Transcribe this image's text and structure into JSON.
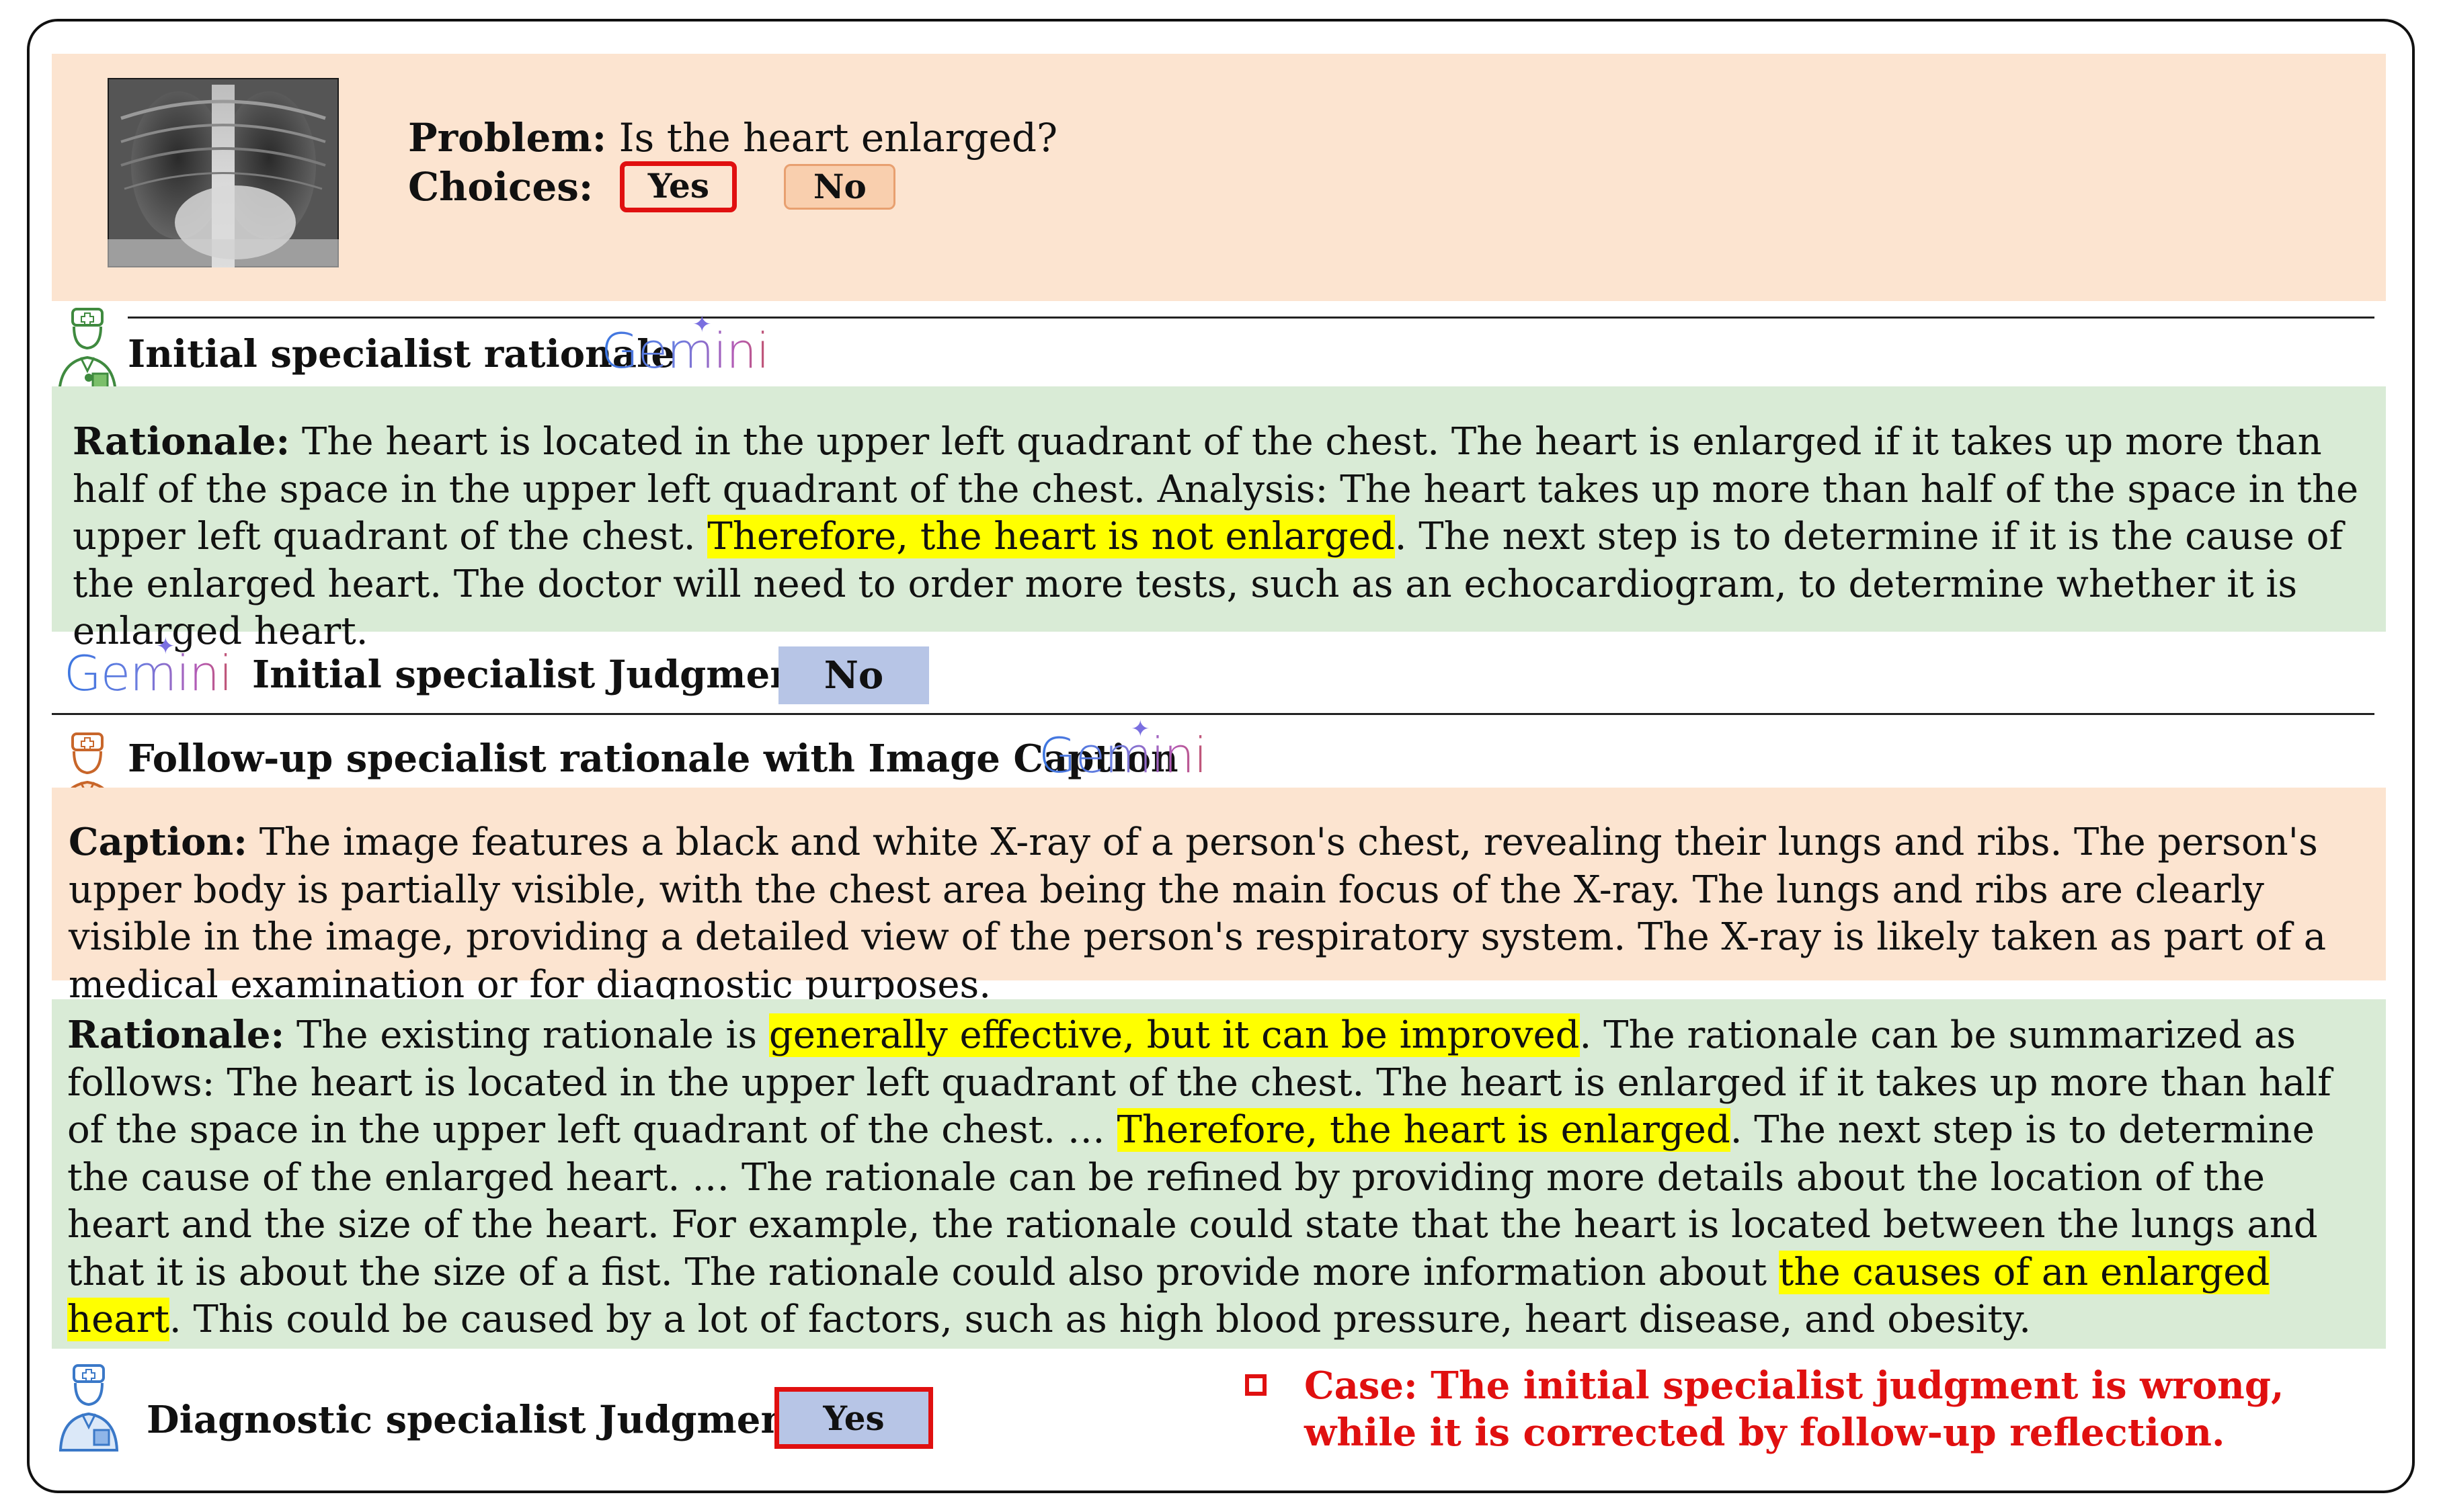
{
  "problem": {
    "label": "Problem:",
    "question": "Is the heart enlarged?",
    "choices_label": "Choices:",
    "choices": [
      "Yes",
      "No"
    ],
    "selected_choice": "Yes"
  },
  "gemini_logo_text": "Gemini",
  "initial": {
    "title": "Initial specialist rationale",
    "rationale_label": "Rationale:",
    "rationale_part1": " The heart is located in the upper left quadrant of the chest. The heart is enlarged if it takes up more than half of the space in the upper left quadrant of the chest. Analysis: The heart takes up more than half of the space in the upper left quadrant of the chest. ",
    "rationale_highlight": "Therefore, the heart is not enlarged",
    "rationale_part2": ". The next step is to determine if it is the cause of the enlarged heart. The doctor will need to order more tests, such as an echocardiogram, to determine whether it is enlarged heart.",
    "judgment_title": "Initial specialist Judgment",
    "judgment_value": "No"
  },
  "followup": {
    "title": "Follow-up specialist rationale with Image Caption",
    "caption_label": "Caption:",
    "caption_text": " The image features a black and white X-ray of a person's chest, revealing their lungs and ribs. The person's upper body is partially visible, with the chest area being the main focus of the X-ray. The lungs and ribs are clearly visible in the image, providing a detailed view of the person's respiratory system. The X-ray is likely taken as part of a medical examination or for diagnostic purposes.",
    "rationale_label": "Rationale:",
    "r1": " The existing rationale is ",
    "r1_highlight": "generally effective, but it can be improved",
    "r2": ". The rationale can be summarized as follows: The heart is located in the upper left quadrant of the chest. The heart is enlarged if it takes up more than half of the space in the upper left quadrant of the chest. … ",
    "r2_highlight": "Therefore, the heart is enlarged",
    "r3": ". The next step is to determine the cause of the enlarged heart. … The rationale can be refined by providing more details about the location of the heart and the size of the heart. For example, the rationale could state that the heart is located between the lungs and that it is about the size of a fist. The rationale could also provide more information about ",
    "r3_highlight": "the causes of an enlarged heart",
    "r4": ". This could be caused by a lot of factors, such as high blood pressure, heart disease, and obesity."
  },
  "diagnostic": {
    "judgment_title": "Diagnostic specialist Judgment",
    "judgment_value": "Yes"
  },
  "case_note": {
    "line1": "Case: The initial specialist judgment is wrong,",
    "line2": "while it is corrected by follow-up reflection."
  },
  "colors": {
    "peach": "#fce4d0",
    "green": "#d9ebd6",
    "highlight": "#ffff00",
    "judgment_box": "#b7c5e6",
    "correct_outline": "#e01010",
    "case_text": "#e01010"
  }
}
